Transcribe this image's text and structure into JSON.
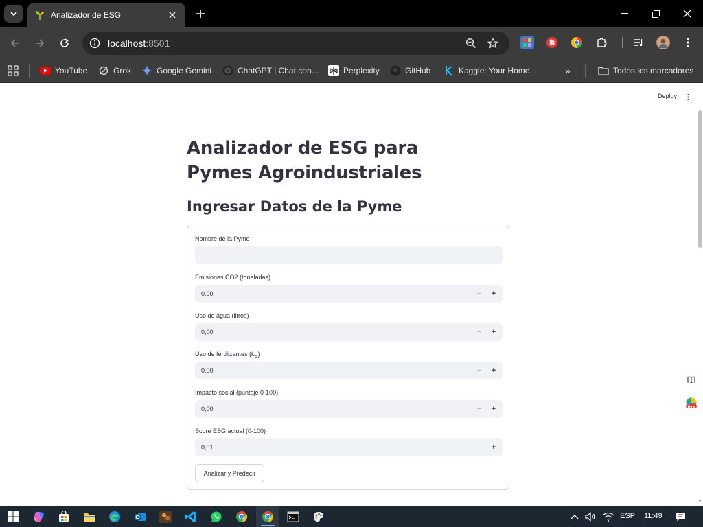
{
  "browser": {
    "tab_title": "Analizador de ESG",
    "url_host": "localhost",
    "url_port": ":8501",
    "bookmarks": [
      {
        "label": "YouTube",
        "icon": "youtube-icon"
      },
      {
        "label": "Grok",
        "icon": "grok-icon"
      },
      {
        "label": "Google Gemini",
        "icon": "gemini-icon"
      },
      {
        "label": "ChatGPT | Chat con...",
        "icon": "chatgpt-icon"
      },
      {
        "label": "Perplexity",
        "icon": "perplexity-icon"
      },
      {
        "label": "GitHub",
        "icon": "github-icon"
      },
      {
        "label": "Kaggle: Your Home...",
        "icon": "kaggle-icon"
      }
    ],
    "all_bookmarks": "Todos los marcadores",
    "more_bookmarks": "»"
  },
  "app": {
    "deploy_label": "Deploy",
    "title": "Analizador de ESG para Pymes Agroindustriales",
    "subtitle": "Ingresar Datos de la Pyme",
    "fields": [
      {
        "label": "Nombre de la Pyme",
        "value": "",
        "type": "text"
      },
      {
        "label": "Emisiones CO2 (toneladas)",
        "value": "0,00",
        "type": "number"
      },
      {
        "label": "Uso de agua (litros)",
        "value": "0,00",
        "type": "number"
      },
      {
        "label": "Uso de fertilizantes (kg)",
        "value": "0,00",
        "type": "number"
      },
      {
        "label": "Impacto social (puntaje 0-100)",
        "value": "0,00",
        "type": "number"
      },
      {
        "label": "Score ESG actual (0-100)",
        "value": "0,01",
        "type": "number"
      }
    ],
    "minus_symbol": "−",
    "plus_symbol": "+",
    "submit_label": "Analizar y Predecir"
  },
  "taskbar": {
    "language": "ESP",
    "time": "11:49"
  },
  "colors": {
    "accent": "#ff4b4b",
    "text": "#31333f",
    "input_bg": "#f0f2f6"
  }
}
